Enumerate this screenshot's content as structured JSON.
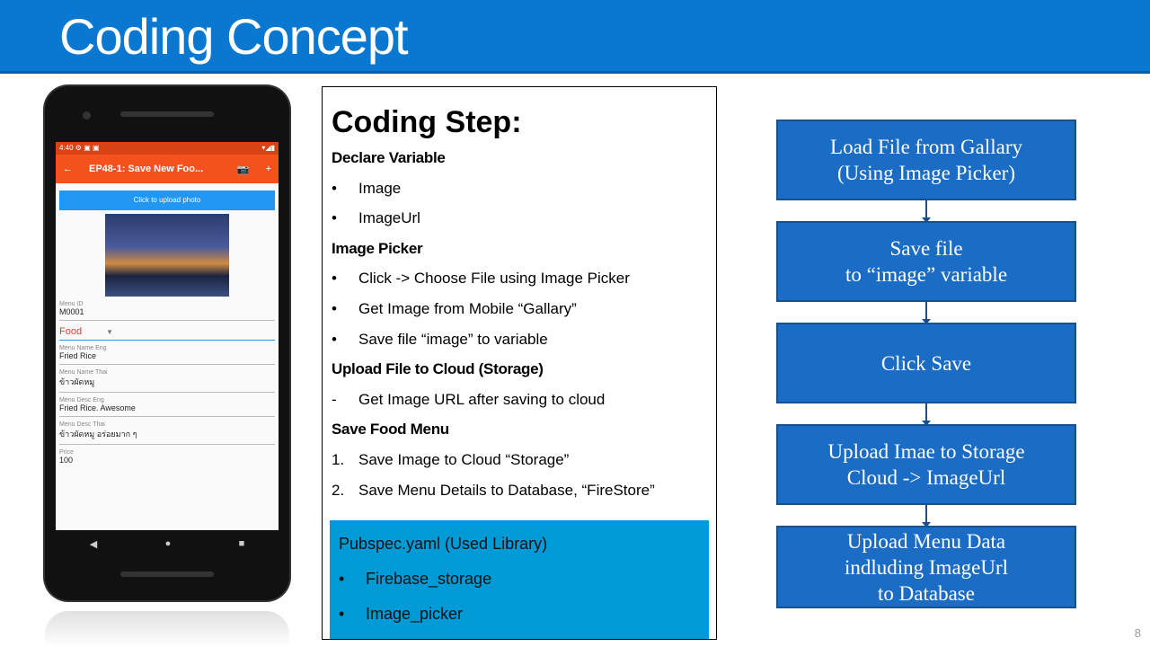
{
  "header": {
    "title": "Coding Concept"
  },
  "phone": {
    "status_time": "4:40",
    "app_title": "EP48-1: Save New Foo...",
    "upload_button": "Click to upload photo",
    "fields": [
      {
        "label": "Menu ID",
        "value": "M0001"
      },
      {
        "label": "Menu Name Eng",
        "value": "Fried Rice"
      },
      {
        "label": "Menu Name Thai",
        "value": "ข้าวผัดหมู"
      },
      {
        "label": "Menu Desc Eng",
        "value": "Fried Rice. Awesome"
      },
      {
        "label": "Menu Desc Thai",
        "value": "ข้าวผัดหมู อร่อยมาก ๆ"
      },
      {
        "label": "Price",
        "value": "100"
      }
    ],
    "category": "Food"
  },
  "steps": {
    "title": "Coding Step:",
    "lines": [
      {
        "bullet": "",
        "text": "Declare Variable",
        "section": true
      },
      {
        "bullet": "•",
        "text": "Image"
      },
      {
        "bullet": "•",
        "text": "ImageUrl"
      },
      {
        "bullet": "",
        "text": "Image Picker",
        "section": true
      },
      {
        "bullet": "•",
        "text": "Click -> Choose File using Image Picker"
      },
      {
        "bullet": "•",
        "text": "Get Image from Mobile “Gallary”"
      },
      {
        "bullet": "•",
        "text": "Save file “image” to variable"
      },
      {
        "bullet": "",
        "text": "Upload File to Cloud (Storage)",
        "section": true
      },
      {
        "bullet": "-",
        "text": "Get Image URL after saving to cloud"
      },
      {
        "bullet": "",
        "text": "Save Food Menu",
        "section": true
      },
      {
        "bullet": "1.",
        "text": "Save Image to Cloud “Storage”"
      },
      {
        "bullet": "2.",
        "text": "Save Menu Details to Database, “FireStore”"
      }
    ],
    "library": {
      "title": "Pubspec.yaml  (Used Library)",
      "items": [
        "Firebase_storage",
        "Image_picker"
      ]
    }
  },
  "flow": [
    "Load File from Gallary\n(Using Image Picker)",
    "Save file\nto “image” variable",
    "Click Save",
    "Upload Imae to Storage\nCloud -> ImageUrl",
    "Upload Menu Data\nindluding ImageUrl\nto Database"
  ],
  "page_number": "8"
}
